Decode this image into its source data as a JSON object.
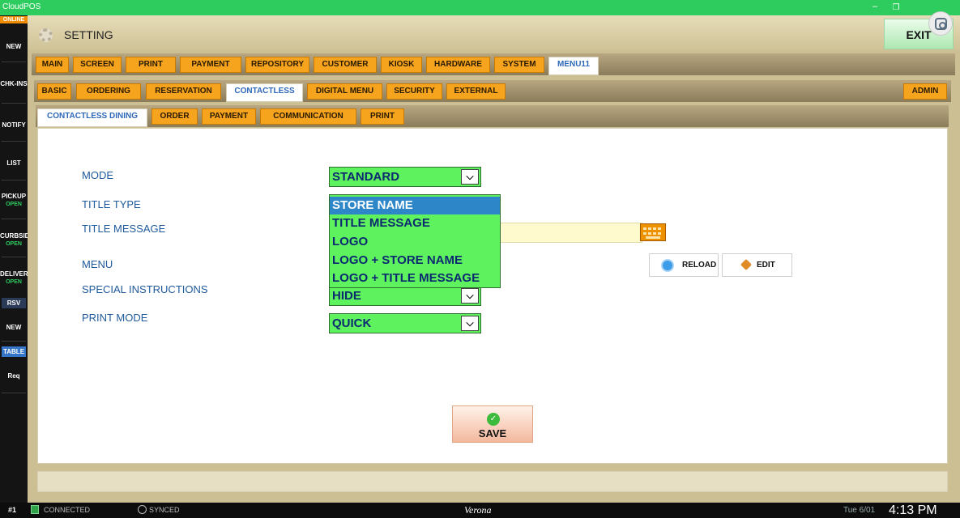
{
  "app": {
    "name": "CloudPOS"
  },
  "sidebar": {
    "online_badge": "ONLINE",
    "items": [
      {
        "label": "NEW",
        "sub": ""
      },
      {
        "label": "CHK-INS",
        "sub": ""
      },
      {
        "label": "NOTIFY",
        "sub": ""
      },
      {
        "label": "LIST",
        "sub": ""
      },
      {
        "label": "PICKUP",
        "sub": "OPEN"
      },
      {
        "label": "CURBSID",
        "sub": "OPEN"
      },
      {
        "label": "DELIVER",
        "sub": "OPEN"
      }
    ],
    "rsv_label": "RSV",
    "rsv_new": "NEW",
    "table_label": "TABLE",
    "req_label": "Req"
  },
  "header": {
    "title": "SETTING",
    "exit_label": "EXIT"
  },
  "main_tabs": [
    "MAIN",
    "SCREEN",
    "PRINT",
    "PAYMENT",
    "REPOSITORY",
    "CUSTOMER",
    "KIOSK",
    "HARDWARE",
    "SYSTEM",
    "MENU11"
  ],
  "main_tabs_active": "MENU11",
  "sub_tabs": [
    "BASIC",
    "ORDERING",
    "RESERVATION",
    "CONTACTLESS",
    "DIGITAL MENU",
    "SECURITY",
    "EXTERNAL"
  ],
  "sub_tabs_active": "CONTACTLESS",
  "admin_label": "ADMIN",
  "section_tabs": [
    "CONTACTLESS DINING",
    "ORDER",
    "PAYMENT",
    "COMMUNICATION",
    "PRINT"
  ],
  "section_tabs_active": "CONTACTLESS DINING",
  "form": {
    "mode_label": "MODE",
    "mode_value": "STANDARD",
    "title_type_label": "TITLE TYPE",
    "title_message_label": "TITLE MESSAGE",
    "menu_label": "MENU",
    "reload_label": "RELOAD",
    "edit_label": "EDIT",
    "special_instructions_label": "SPECIAL INSTRUCTIONS",
    "special_instructions_value": "HIDE",
    "print_mode_label": "PRINT MODE",
    "print_mode_value": "QUICK",
    "title_type_options": [
      "STORE NAME",
      "TITLE MESSAGE",
      "LOGO",
      "LOGO + STORE NAME",
      "LOGO + TITLE MESSAGE"
    ],
    "title_type_selected": "STORE NAME"
  },
  "save_label": "SAVE",
  "status": {
    "station": "#1",
    "connected": "CONNECTED",
    "synced": "SYNCED",
    "store": "Verona",
    "date": "Tue 6/01",
    "time": "4:13 PM"
  },
  "colors": {
    "tab_bg": "#f6a41e",
    "select_green": "#5ef25f",
    "select_text": "#0b2a6f",
    "label_blue": "#1f5a9c",
    "titlebar_green": "#2ecc5e"
  }
}
